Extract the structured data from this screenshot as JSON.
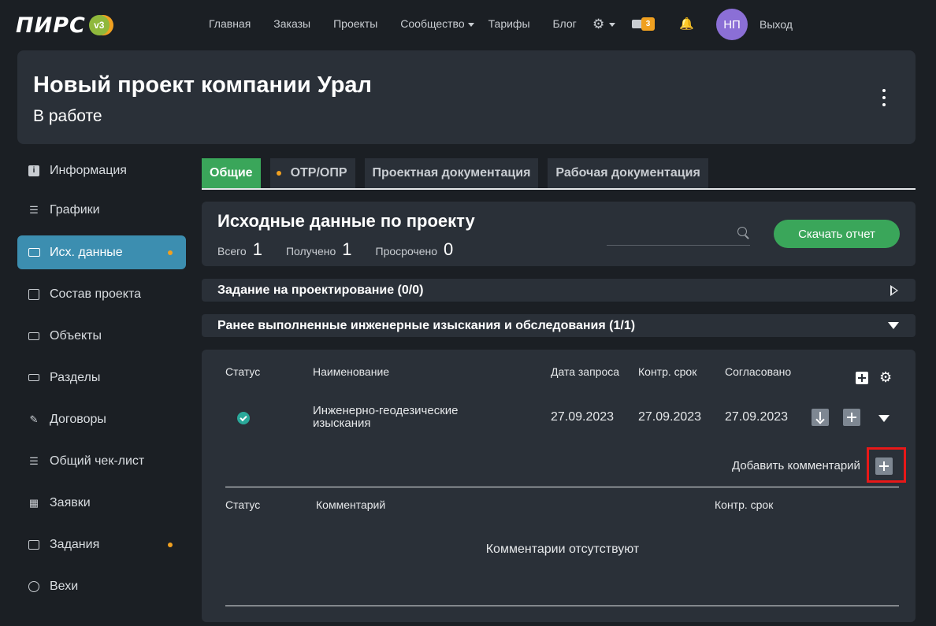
{
  "logo": {
    "text": "ПИРС",
    "badge": "v3"
  },
  "nav": {
    "links": [
      "Главная",
      "Заказы",
      "Проекты",
      "Сообщество",
      "Тарифы",
      "Блог"
    ],
    "messages_count": "3",
    "avatar_initials": "НП",
    "logout": "Выход"
  },
  "header": {
    "title": "Новый проект компании Урал",
    "status": "В работе"
  },
  "sidebar": {
    "items": [
      {
        "label": "Информация",
        "icon": "info-icon"
      },
      {
        "label": "Графики",
        "icon": "gantt-icon"
      },
      {
        "label": "Исх. данные",
        "icon": "folder-icon",
        "active": true,
        "dot": true
      },
      {
        "label": "Состав проекта",
        "icon": "book-icon"
      },
      {
        "label": "Объекты",
        "icon": "layers-icon"
      },
      {
        "label": "Разделы",
        "icon": "sections-icon"
      },
      {
        "label": "Договоры",
        "icon": "pen-icon"
      },
      {
        "label": "Общий чек-лист",
        "icon": "checklist-icon"
      },
      {
        "label": "Заявки",
        "icon": "grid-icon"
      },
      {
        "label": "Задания",
        "icon": "tasks-icon",
        "dot": true
      },
      {
        "label": "Вехи",
        "icon": "check-circle-icon"
      }
    ]
  },
  "tabs": [
    {
      "label": "Общие",
      "active": true
    },
    {
      "label": "ОТР/ОПР",
      "dot": true
    },
    {
      "label": "Проектная документация"
    },
    {
      "label": "Рабочая документация"
    }
  ],
  "summary": {
    "title": "Исходные данные по проекту",
    "total_label": "Всего",
    "total": "1",
    "received_label": "Получено",
    "received": "1",
    "overdue_label": "Просрочено",
    "overdue": "0",
    "search_placeholder": "",
    "report_button": "Скачать отчет"
  },
  "accordions": [
    {
      "label": "Задание на проектирование (0/0)",
      "expanded": false
    },
    {
      "label": "Ранее выполненные инженерные изыскания и обследования (1/1)",
      "expanded": true
    }
  ],
  "table": {
    "headers": [
      "Статус",
      "Наименование",
      "Дата запроса",
      "Контр. срок",
      "Согласовано"
    ],
    "rows": [
      {
        "status": "done",
        "name": "Инженерно-геодезические изыскания",
        "request_date": "27.09.2023",
        "deadline": "27.09.2023",
        "approved": "27.09.2023"
      }
    ],
    "add_comment": "Добавить комментарий",
    "comment_headers": [
      "Статус",
      "Комментарий",
      "Контр. срок"
    ],
    "no_comments": "Комментарии отсутствуют"
  },
  "colors": {
    "accent_green": "#3aa65a",
    "active_blue": "#3c8eb0",
    "dot_orange": "#f0a020",
    "highlight_red": "#e81818"
  }
}
